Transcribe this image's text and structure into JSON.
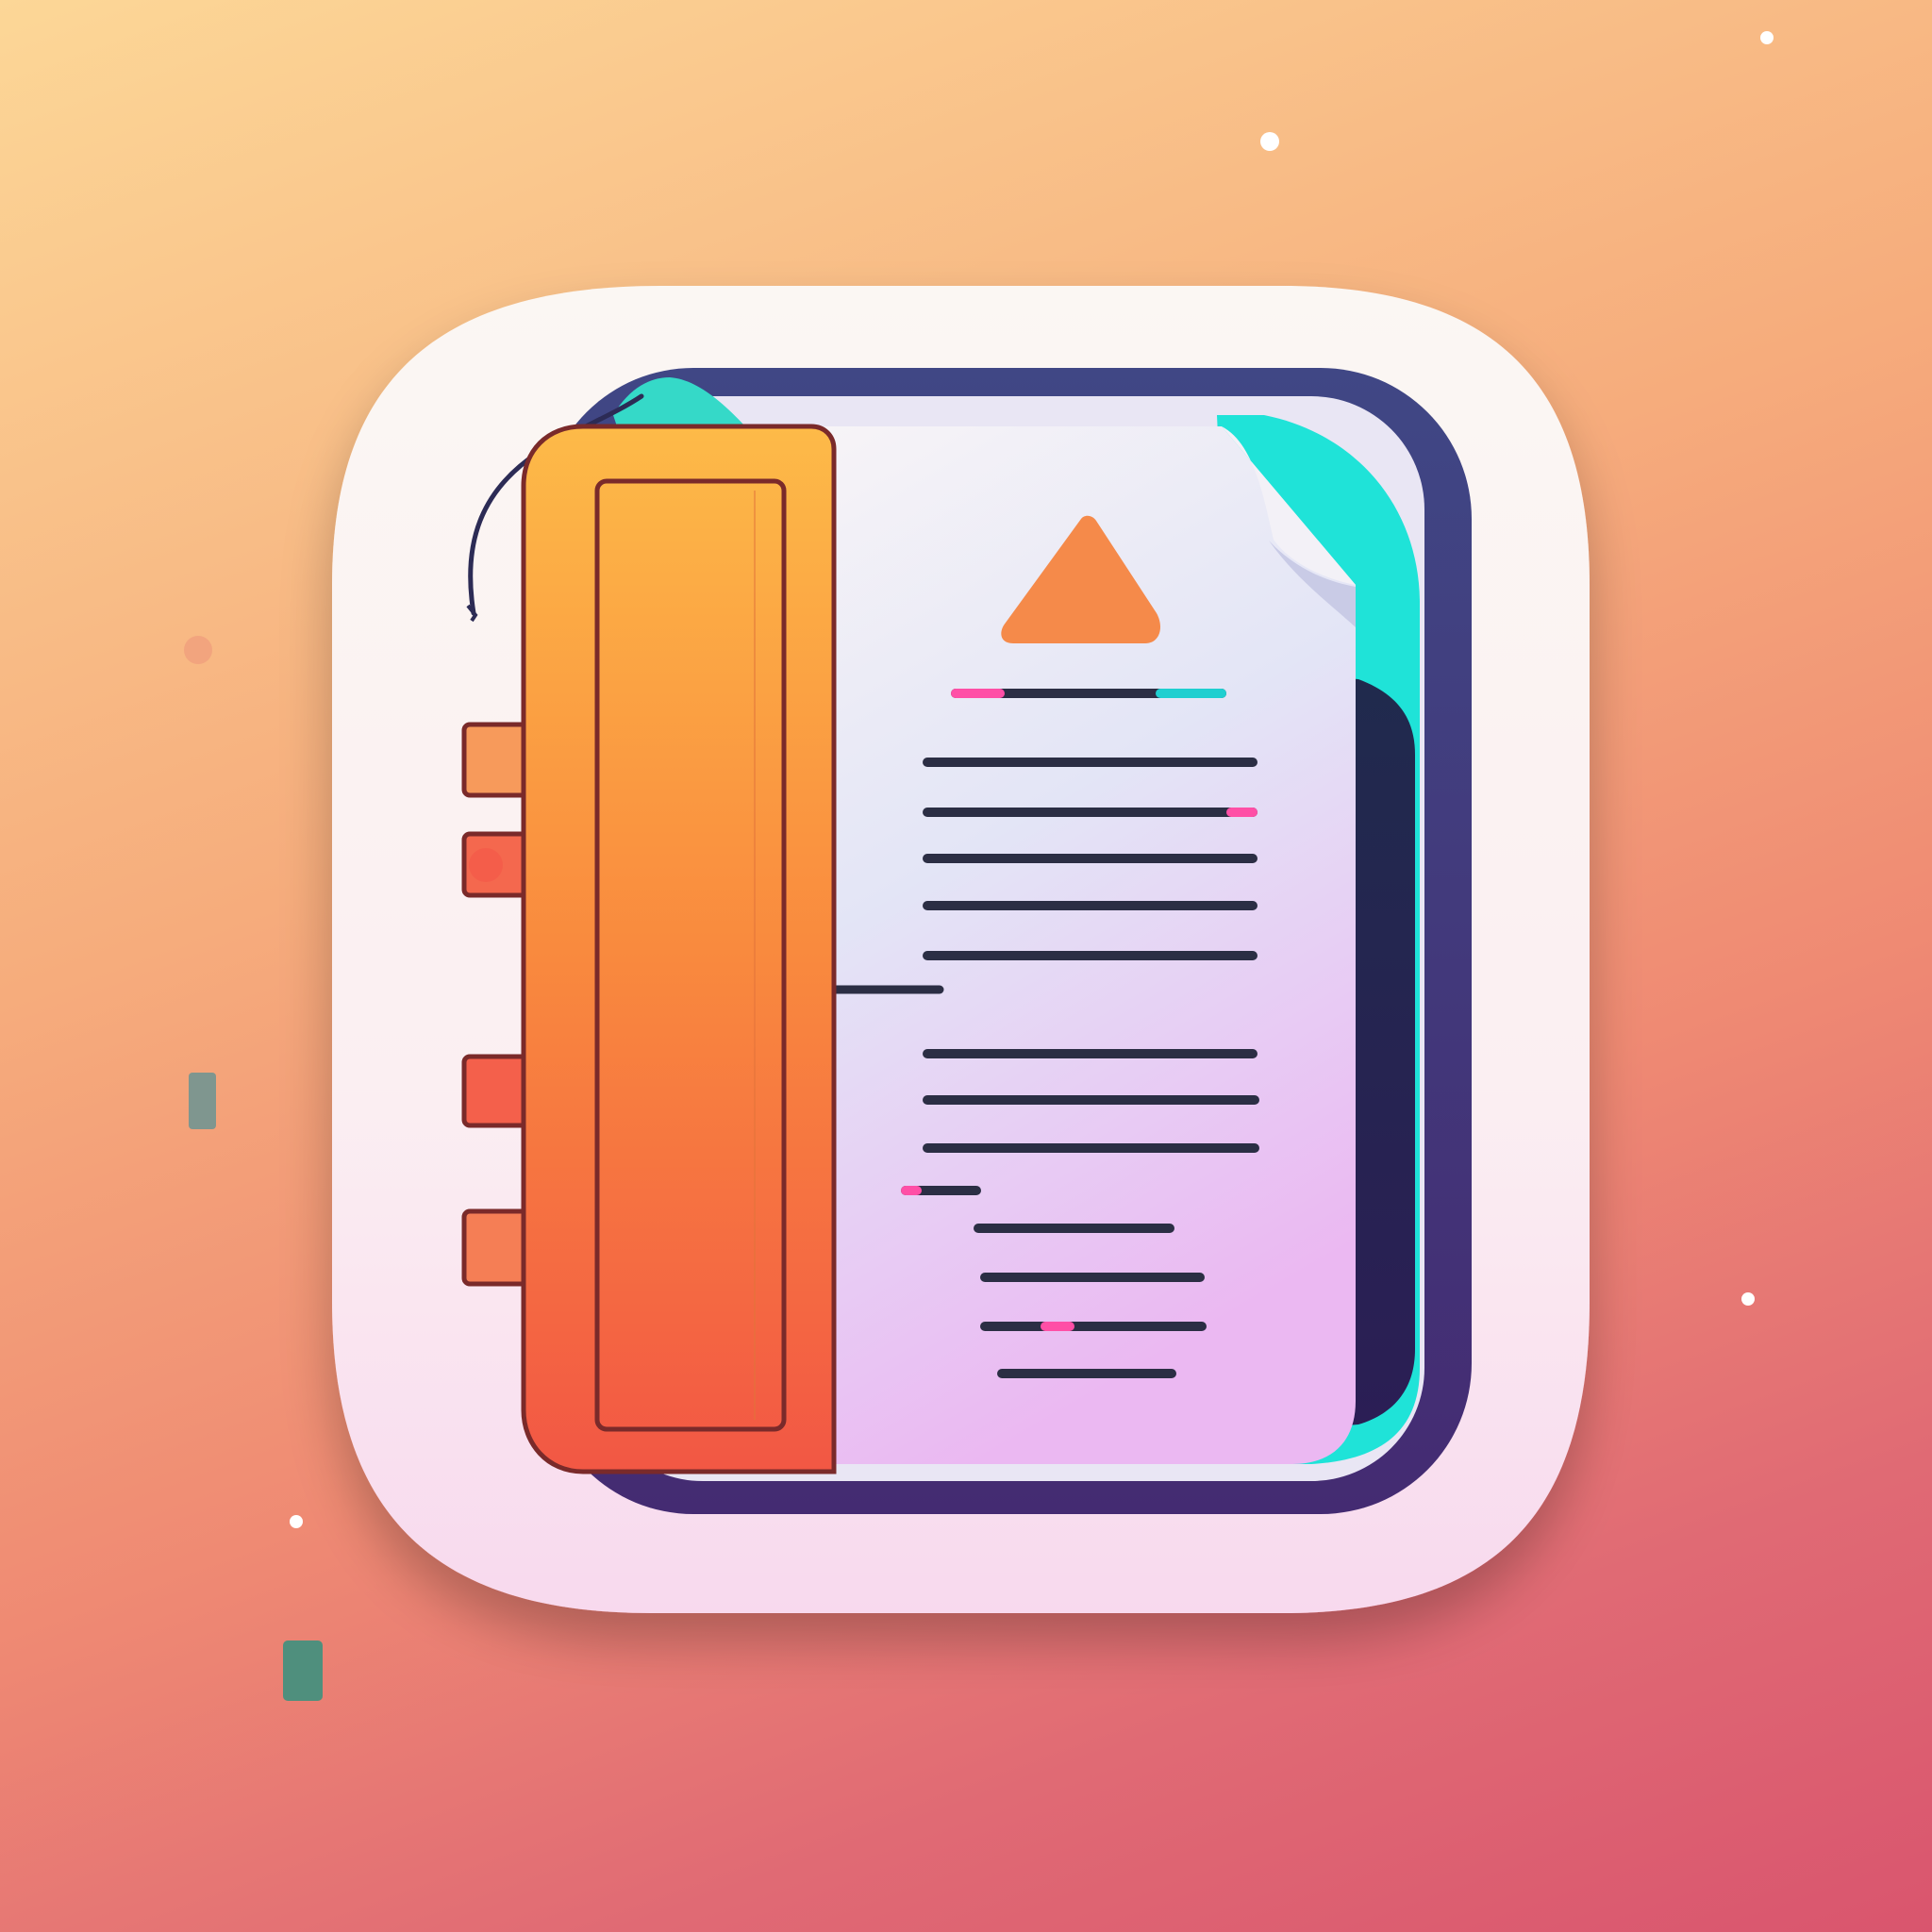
{
  "icon": {
    "name": "notebook-document-app-icon"
  },
  "colors": {
    "tile_top": "#fbf6f2",
    "tile_bottom": "#f8dcef",
    "frame_navy": "#3d3f7f",
    "frame_teal": "#1fe3d8",
    "binder_top": "#fdb94a",
    "binder_bottom": "#f25a45",
    "binder_outline": "#7a2a2a",
    "page_top": "#f6f4f8",
    "page_bottom": "#e8b8f3",
    "text_line": "#2b2e44",
    "accent_pink": "#ff4fa6",
    "accent_teal": "#1fcfd0",
    "triangle": "#f58a4a"
  }
}
